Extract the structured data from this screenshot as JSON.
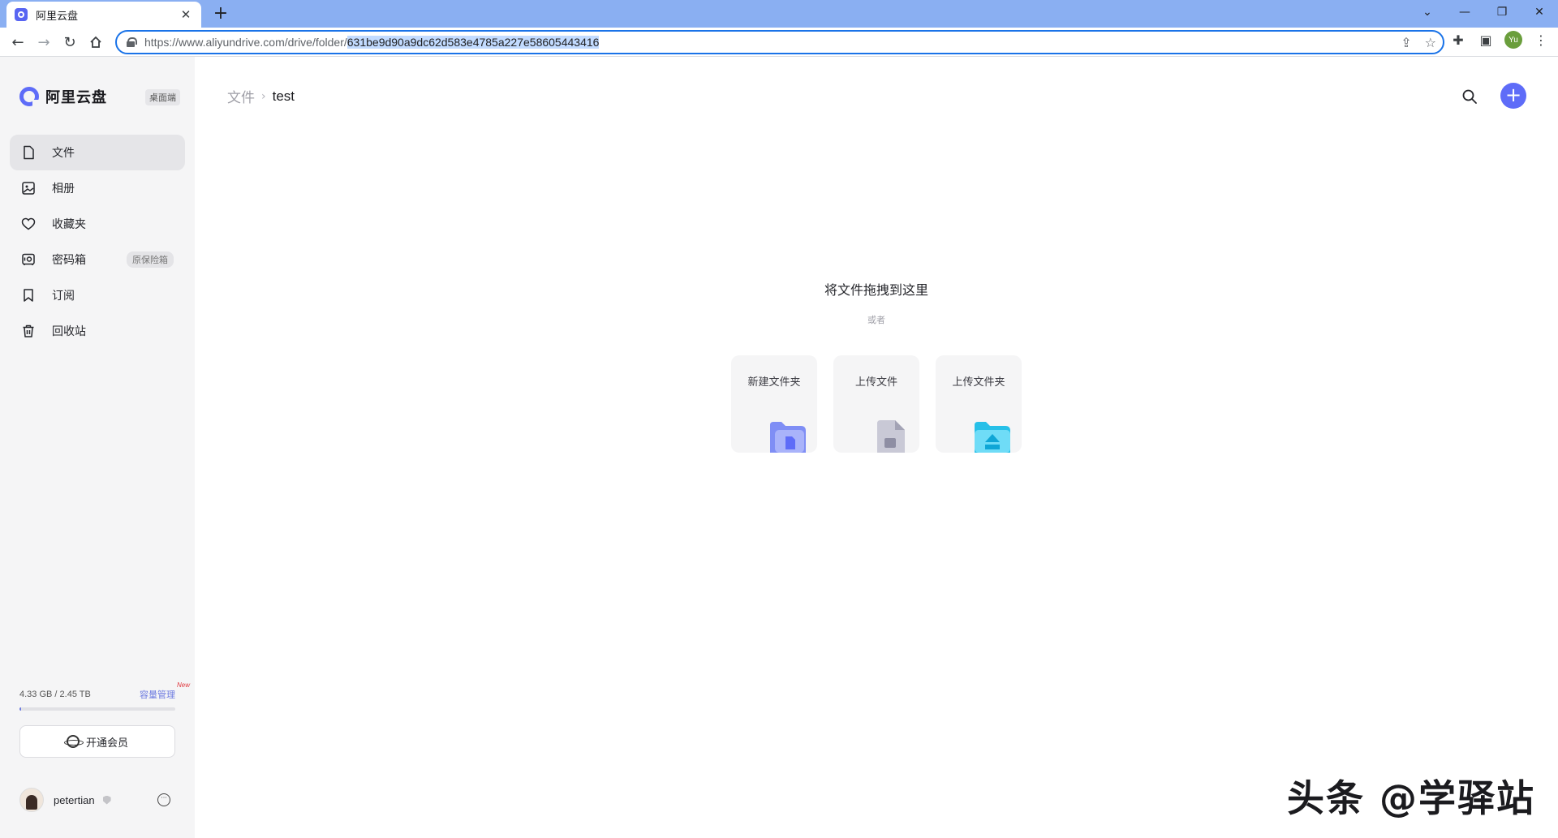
{
  "browser": {
    "tab_title": "阿里云盘",
    "tab_close": "✕",
    "new_tab": "+",
    "url_prefix": "https://www.aliyundrive.com/drive/folder/",
    "url_selected": "631be9d90a9dc62d583e4785a227e58605443416",
    "profile_initials": "Yu"
  },
  "sidebar": {
    "logo_text": "阿里云盘",
    "desktop_badge": "桌面端",
    "items": [
      {
        "label": "文件",
        "icon": "file-icon",
        "active": true
      },
      {
        "label": "相册",
        "icon": "photo-icon"
      },
      {
        "label": "收藏夹",
        "icon": "heart-icon"
      },
      {
        "label": "密码箱",
        "icon": "safe-icon",
        "tag": "原保险箱"
      },
      {
        "label": "订阅",
        "icon": "bookmark-icon"
      },
      {
        "label": "回收站",
        "icon": "trash-icon"
      }
    ],
    "storage": {
      "usage": "4.33 GB / 2.45 TB",
      "manage_link": "容量管理",
      "manage_badge": "New",
      "used_fraction": 0.0018
    },
    "vip_button": "开通会员",
    "user": {
      "name": "petertian"
    }
  },
  "main": {
    "breadcrumb_root": "文件",
    "breadcrumb_current": "test",
    "drop_title": "将文件拖拽到这里",
    "drop_or": "或者",
    "actions": [
      {
        "label": "新建文件夹",
        "icon": "new-folder-icon"
      },
      {
        "label": "上传文件",
        "icon": "upload-file-icon"
      },
      {
        "label": "上传文件夹",
        "icon": "upload-folder-icon"
      }
    ]
  },
  "watermark": "头条 @学驿站",
  "colors": {
    "accent": "#5e6cf8",
    "sidebar_bg": "#f5f5f6",
    "browser_frame": "#8aaff2"
  }
}
